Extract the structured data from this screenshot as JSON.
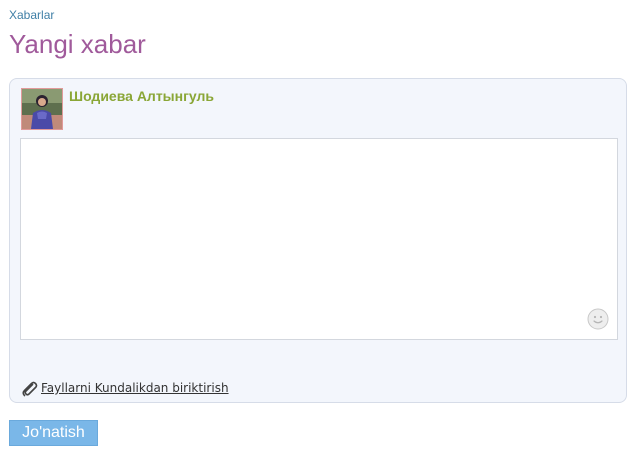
{
  "breadcrumb": {
    "label": "Xabarlar"
  },
  "page": {
    "title": "Yangi xabar"
  },
  "message_form": {
    "sender_name": "Шодиева Алтынгуль",
    "avatar_icon": "user-photo",
    "textarea_value": "",
    "emoji_icon": "smiley-icon",
    "attach_icon": "paperclip-icon",
    "attach_label": "Fayllarni Kundalikdan biriktirish"
  },
  "actions": {
    "send_label": "Jo'natish"
  },
  "colors": {
    "title": "#a05a9b",
    "sender": "#8aa636",
    "link": "#3f7fa6",
    "panel_bg": "#f3f6fc",
    "button_bg": "#7ab7e8"
  }
}
